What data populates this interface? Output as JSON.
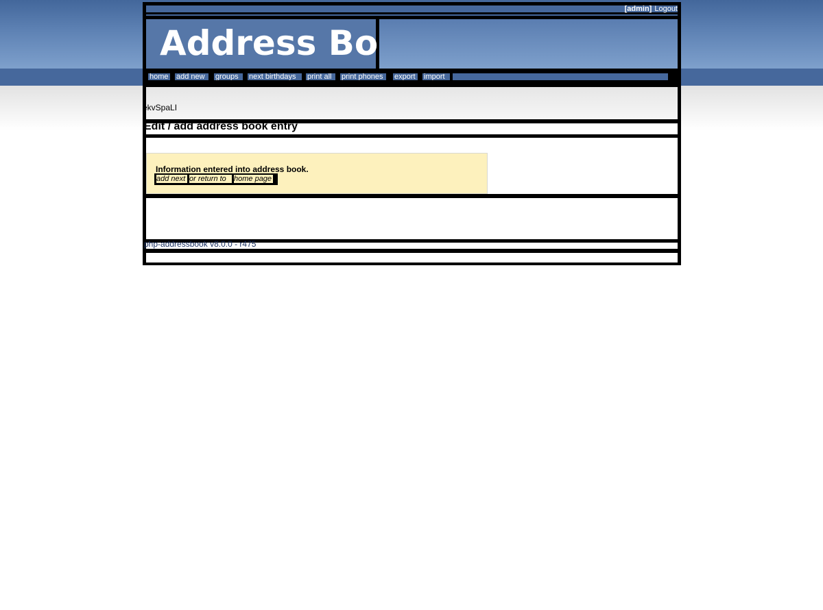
{
  "header": {
    "user": "[admin]",
    "logout_label": "Logout",
    "logo_text": "Address Book"
  },
  "nav": {
    "items": [
      {
        "label": "home"
      },
      {
        "label": "add new"
      },
      {
        "label": "groups"
      },
      {
        "label": "next birthdays"
      },
      {
        "label": "print all"
      },
      {
        "label": "print phones"
      },
      {
        "label": "export"
      },
      {
        "label": "import"
      }
    ]
  },
  "subheader": {
    "token": "ekvSpaLI"
  },
  "page": {
    "title": "Edit / add address book entry"
  },
  "message": {
    "text": "Information entered into address book.",
    "add_next_label": "add next",
    "middle_text": "or return to",
    "home_page_label": "home page"
  },
  "footer": {
    "version_label": "php-addressbook v8.0.0 - r475"
  },
  "colors": {
    "nav_blue": "#46689c",
    "message_bg": "#fdf1bd",
    "border": "#000000"
  }
}
